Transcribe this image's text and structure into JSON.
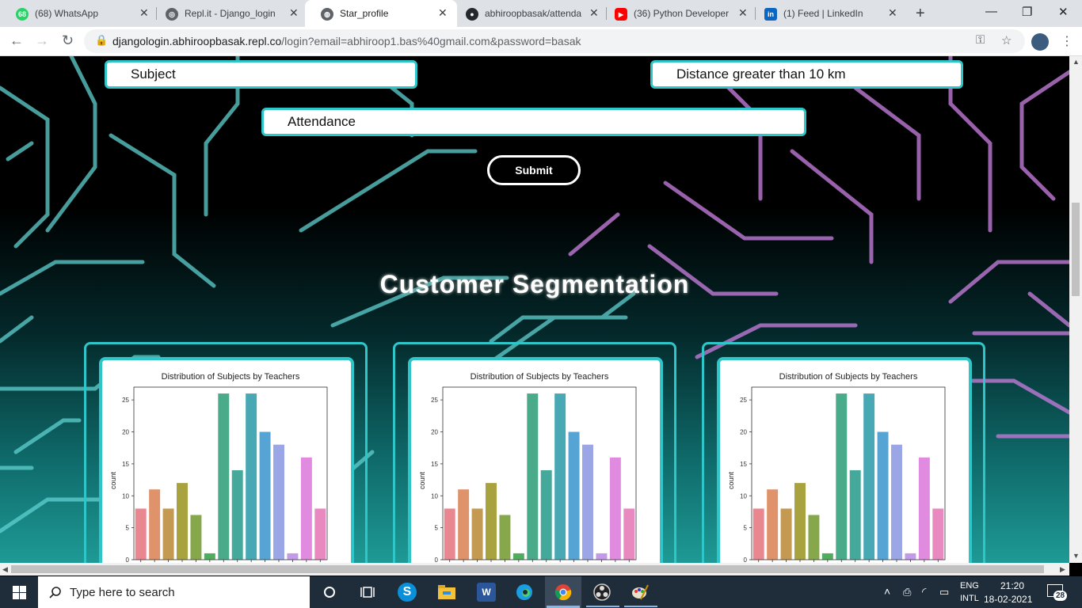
{
  "browser": {
    "tabs": [
      {
        "title": "(68) WhatsApp",
        "favicon_text": "68",
        "favicon_color": "#25d366"
      },
      {
        "title": "Repl.it - Django_login",
        "favicon_text": "◎",
        "favicon_color": "#5f6368"
      },
      {
        "title": "Star_profile",
        "favicon_text": "◍",
        "favicon_color": "#5f6368"
      },
      {
        "title": "abhiroopbasak/attenda",
        "favicon_text": "●",
        "favicon_color": "#24292e"
      },
      {
        "title": "(36) Python Developer",
        "favicon_text": "▶",
        "favicon_color": "#ff0000"
      },
      {
        "title": "(1) Feed | LinkedIn",
        "favicon_text": "in",
        "favicon_color": "#0a66c2"
      }
    ],
    "close_glyph": "✕",
    "new_tab_glyph": "+",
    "window_controls": {
      "minimize": "—",
      "restore": "❐",
      "close": "✕"
    },
    "url_host": "djangologin.abhiroopbasak.repl.co",
    "url_rest": "/login?email=abhiroop1.bas%40gmail.com&password=basak",
    "icons": {
      "back": "←",
      "forward": "→",
      "reload": "↻",
      "lock": "🔒",
      "key": "⚿",
      "star": "☆",
      "menu": "⋮"
    }
  },
  "form": {
    "subject_value": "Subject",
    "distance_value": "Distance greater than 10 km",
    "attendance_value": "Attendance",
    "submit_label": "Submit"
  },
  "section": {
    "title": "Customer Segmentation"
  },
  "chart_data": [
    {
      "type": "bar",
      "title": "Distribution of Subjects by Teachers",
      "ylabel": "count",
      "ylim": [
        0,
        27
      ],
      "yticks": [
        0,
        5,
        10,
        15,
        20,
        25
      ],
      "values": [
        8,
        11,
        8,
        12,
        7,
        1,
        26,
        14,
        26,
        20,
        18,
        1,
        16,
        8
      ],
      "colors": [
        "#e8878f",
        "#e0926a",
        "#c49a52",
        "#a8a23f",
        "#86a74a",
        "#4fae5e",
        "#4aab8a",
        "#44a89a",
        "#48a8b4",
        "#55a4d4",
        "#9aa6e6",
        "#c29ae8",
        "#e08ae0",
        "#e889c0"
      ]
    },
    {
      "type": "bar",
      "title": "Distribution of Subjects by Teachers",
      "ylabel": "count",
      "ylim": [
        0,
        27
      ],
      "yticks": [
        0,
        5,
        10,
        15,
        20,
        25
      ],
      "values": [
        8,
        11,
        8,
        12,
        7,
        1,
        26,
        14,
        26,
        20,
        18,
        1,
        16,
        8
      ],
      "colors": [
        "#e8878f",
        "#e0926a",
        "#c49a52",
        "#a8a23f",
        "#86a74a",
        "#4fae5e",
        "#4aab8a",
        "#44a89a",
        "#48a8b4",
        "#55a4d4",
        "#9aa6e6",
        "#c29ae8",
        "#e08ae0",
        "#e889c0"
      ]
    },
    {
      "type": "bar",
      "title": "Distribution of Subjects by Teachers",
      "ylabel": "count",
      "ylim": [
        0,
        27
      ],
      "yticks": [
        0,
        5,
        10,
        15,
        20,
        25
      ],
      "values": [
        8,
        11,
        8,
        12,
        7,
        1,
        26,
        14,
        26,
        20,
        18,
        1,
        16,
        8
      ],
      "colors": [
        "#e8878f",
        "#e0926a",
        "#c49a52",
        "#a8a23f",
        "#86a74a",
        "#4fae5e",
        "#4aab8a",
        "#44a89a",
        "#48a8b4",
        "#55a4d4",
        "#9aa6e6",
        "#c29ae8",
        "#e08ae0",
        "#e889c0"
      ]
    }
  ],
  "taskbar": {
    "search_placeholder": "Type here to search",
    "language": "ENG",
    "layout": "INTL",
    "time": "21:20",
    "date": "18-02-2021",
    "notifications": "28"
  },
  "colors": {
    "accent": "#2fc6c9",
    "circuit_teal": "#5fd0d0",
    "circuit_purple": "#c07ad6"
  }
}
